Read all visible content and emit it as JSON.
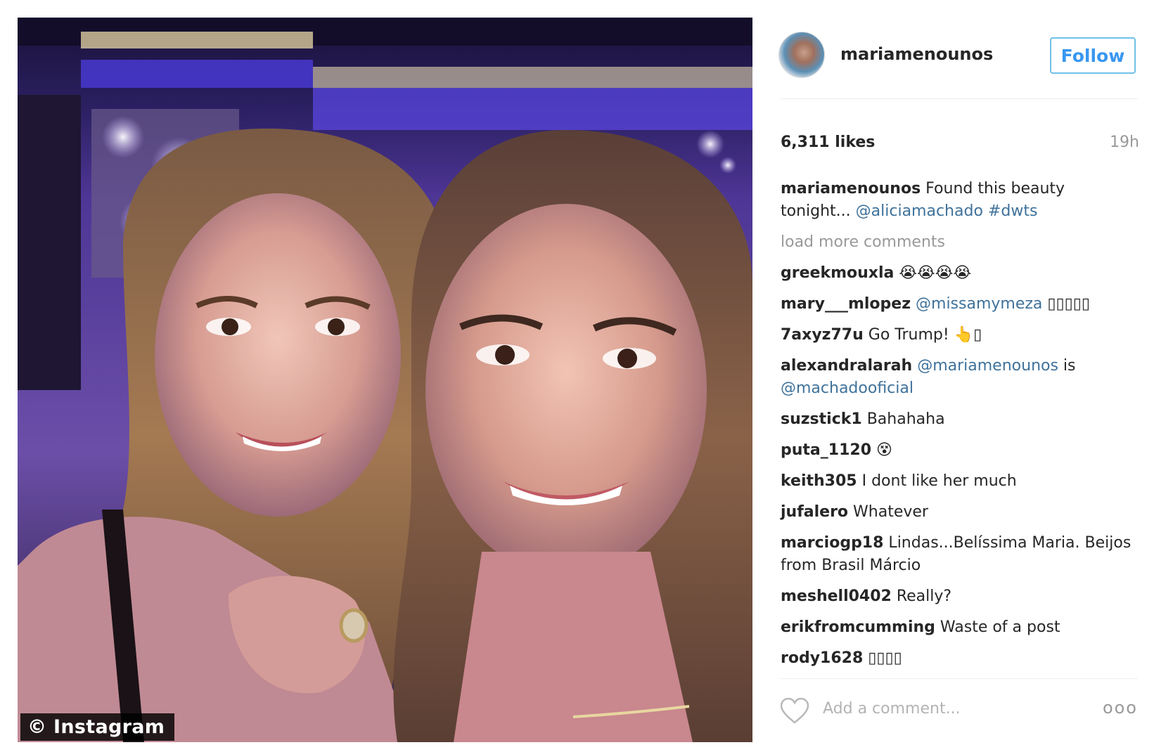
{
  "photo": {
    "watermark": "© Instagram"
  },
  "post": {
    "username": "mariamenounos",
    "follow_label": "Follow",
    "likes": "6,311 likes",
    "time": "19h",
    "caption": {
      "user": "mariamenounos",
      "text": "Found this beauty tonight... ",
      "mention": "@aliciamachado",
      "hashtag": "#dwts"
    },
    "load_more": "load more comments",
    "comments": [
      {
        "user": "greekmouxla",
        "text": " 😭😭😭😭",
        "mention": "",
        "after": ""
      },
      {
        "user": "mary___mlopez",
        "text": " ",
        "mention": "@missamymeza",
        "after": " ▯▯▯▯▯"
      },
      {
        "user": "7axyz77u",
        "text": " Go Trump! 👆▯",
        "mention": "",
        "after": ""
      },
      {
        "user": "alexandralarah",
        "text": " ",
        "mention": "@mariamenounos",
        "after": " is @machadooficial"
      },
      {
        "user": "suzstick1",
        "text": " Bahahaha",
        "mention": "",
        "after": ""
      },
      {
        "user": "puta_1120",
        "text": " 😵",
        "mention": "",
        "after": ""
      },
      {
        "user": "keith305",
        "text": " I dont like her much",
        "mention": "",
        "after": ""
      },
      {
        "user": "jufalero",
        "text": " Whatever",
        "mention": "",
        "after": ""
      },
      {
        "user": "marciogp18",
        "text": " Lindas...Belíssima Maria. Beijos from Brasil Márcio",
        "mention": "",
        "after": ""
      },
      {
        "user": "meshell0402",
        "text": " Really?",
        "mention": "",
        "after": ""
      },
      {
        "user": "erikfromcumming",
        "text": " Waste of a post",
        "mention": "",
        "after": ""
      },
      {
        "user": "rody1628",
        "text": " ▯▯▯▯",
        "mention": "",
        "after": ""
      }
    ],
    "add_comment_placeholder": "Add a comment...",
    "more_label": "ooo"
  },
  "icons": {
    "heart": "heart-icon",
    "more": "more-options-icon"
  },
  "colors": {
    "link": "#3f729b",
    "follow": "#3897f0",
    "muted": "#999999"
  }
}
